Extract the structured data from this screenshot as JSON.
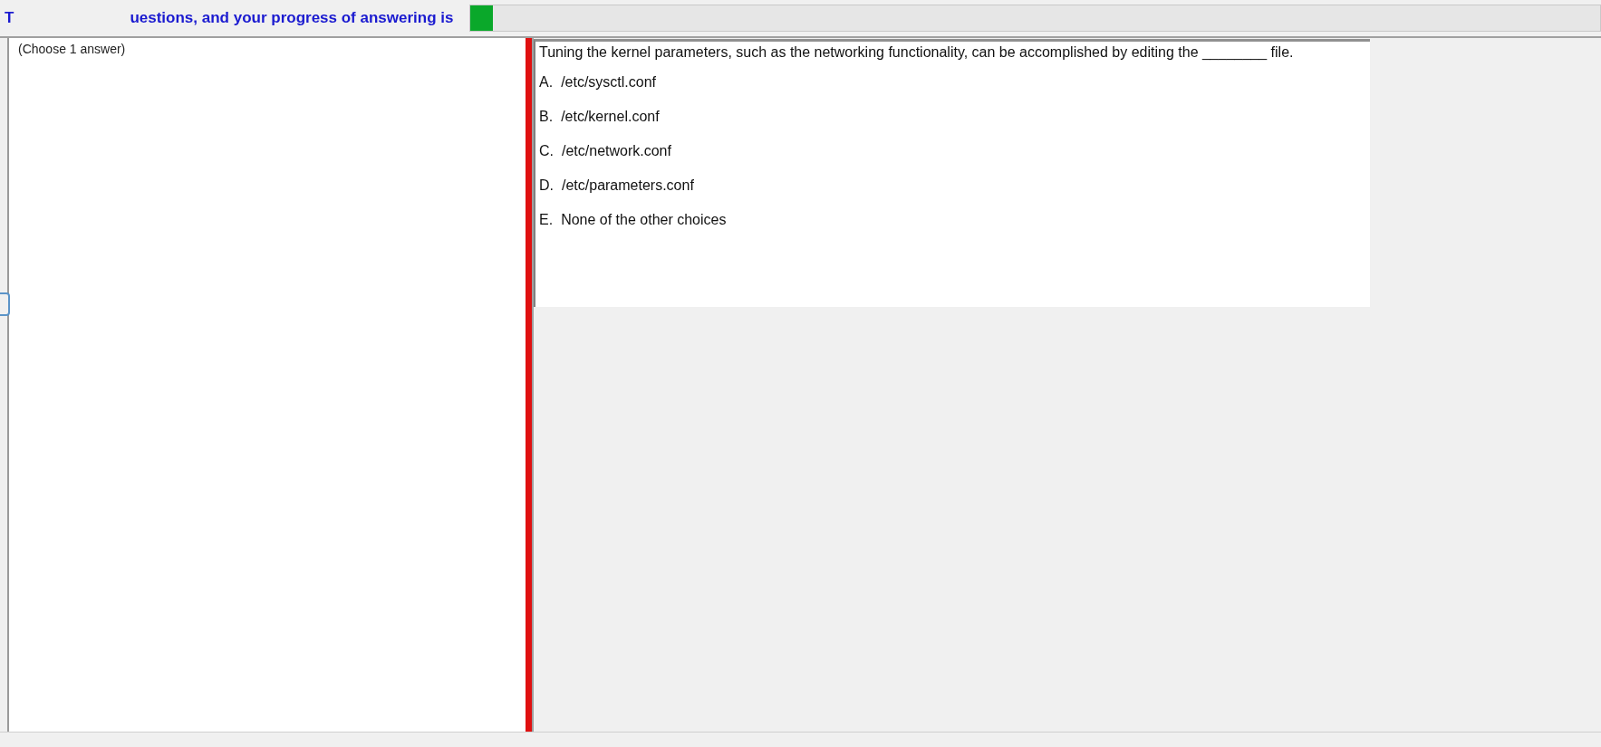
{
  "header": {
    "text_start": "T",
    "text_end": "uestions, and your progress of answering is",
    "progress": {
      "level": 0.02
    }
  },
  "left_panel": {
    "hint": "(Choose 1 answer)"
  },
  "question": {
    "text": "Tuning the kernel parameters, such as the networking functionality, can be accomplished by editing the ________ file.",
    "options": [
      {
        "letter": "A.",
        "text": "/etc/sysctl.conf"
      },
      {
        "letter": "B.",
        "text": "/etc/kernel.conf"
      },
      {
        "letter": "C.",
        "text": "/etc/network.conf"
      },
      {
        "letter": "D.",
        "text": "/etc/parameters.conf"
      },
      {
        "letter": "E.",
        "text": "None of the other choices"
      }
    ]
  }
}
